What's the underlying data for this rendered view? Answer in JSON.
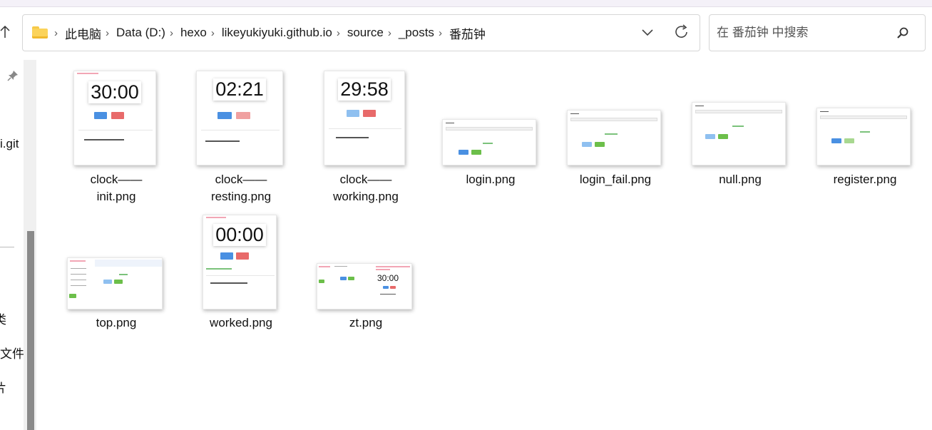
{
  "window": {
    "title": "番茄钟"
  },
  "address": {
    "crumbs": [
      "此电脑",
      "Data (D:)",
      "hexo",
      "likeyukiyuki.github.io",
      "source",
      "_posts",
      "番茄钟"
    ]
  },
  "search": {
    "placeholder": "在 番茄钟 中搜索"
  },
  "nav": {
    "partial_labels": [
      "i.git",
      "类",
      "文件",
      "片"
    ]
  },
  "files": [
    {
      "name_line1": "clock——",
      "name_line2": "init.png",
      "preview_time": "30:00"
    },
    {
      "name_line1": "clock——",
      "name_line2": "resting.png",
      "preview_time": "02:21"
    },
    {
      "name_line1": "clock——",
      "name_line2": "working.png",
      "preview_time": "29:58"
    },
    {
      "name": "login.png"
    },
    {
      "name": "login_fail.png"
    },
    {
      "name": "null.png"
    },
    {
      "name": "register.png"
    },
    {
      "name": "top.png"
    },
    {
      "name": "worked.png",
      "preview_time": "00:00"
    },
    {
      "name": "zt.png",
      "preview_time": "30:00"
    }
  ],
  "colors": {
    "accent_blue": "#4a90e2",
    "accent_red": "#e86a6a",
    "accent_green": "#6cbf4a",
    "light_blue": "#8fc0f0",
    "light_red": "#f0a0a0"
  }
}
